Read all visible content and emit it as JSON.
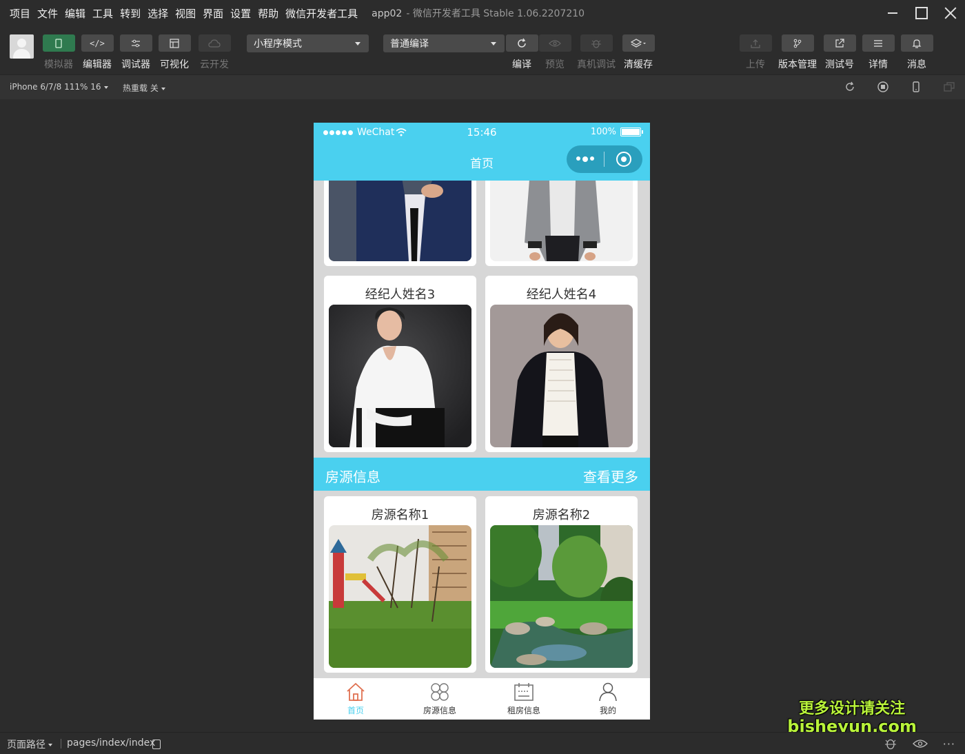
{
  "menu": [
    "项目",
    "文件",
    "编辑",
    "工具",
    "转到",
    "选择",
    "视图",
    "界面",
    "设置",
    "帮助",
    "微信开发者工具"
  ],
  "window_title": {
    "project": "app02",
    "rest": "- 微信开发者工具 Stable 1.06.2207210"
  },
  "toolbar": {
    "simulator": "模拟器",
    "editor": "编辑器",
    "debugger": "调试器",
    "visual": "可视化",
    "cloud": "云开发",
    "mode_select": "小程序模式",
    "compile_select": "普通编译",
    "compile": "编译",
    "preview": "预览",
    "real_debug": "真机调试",
    "clear_cache": "清缓存",
    "upload": "上传",
    "version": "版本管理",
    "test_account": "测试号",
    "details": "详情",
    "messages": "消息"
  },
  "subbar": {
    "device": "iPhone 6/7/8 111% 16",
    "hot_reload": "热重载 关"
  },
  "phone": {
    "carrier": "WeChat",
    "time": "15:46",
    "battery": "100%",
    "nav_title": "首页",
    "agents": [
      {
        "name": "经纪人姓名3"
      },
      {
        "name": "经纪人姓名4"
      }
    ],
    "section": {
      "title": "房源信息",
      "more": "查看更多"
    },
    "houses": [
      {
        "name": "房源名称1"
      },
      {
        "name": "房源名称2"
      }
    ],
    "tabs": [
      {
        "label": "首页",
        "icon": "home-icon"
      },
      {
        "label": "房源信息",
        "icon": "grid-icon"
      },
      {
        "label": "租房信息",
        "icon": "calendar-icon"
      },
      {
        "label": "我的",
        "icon": "user-icon"
      }
    ]
  },
  "bottom": {
    "path_label": "页面路径",
    "path_value": "pages/index/index"
  },
  "watermark": {
    "line1": "更多设计请关注",
    "line2": "bisheyun.com"
  },
  "colors": {
    "accent": "#4ad0ef",
    "simulator_active": "#2f7a4f"
  }
}
